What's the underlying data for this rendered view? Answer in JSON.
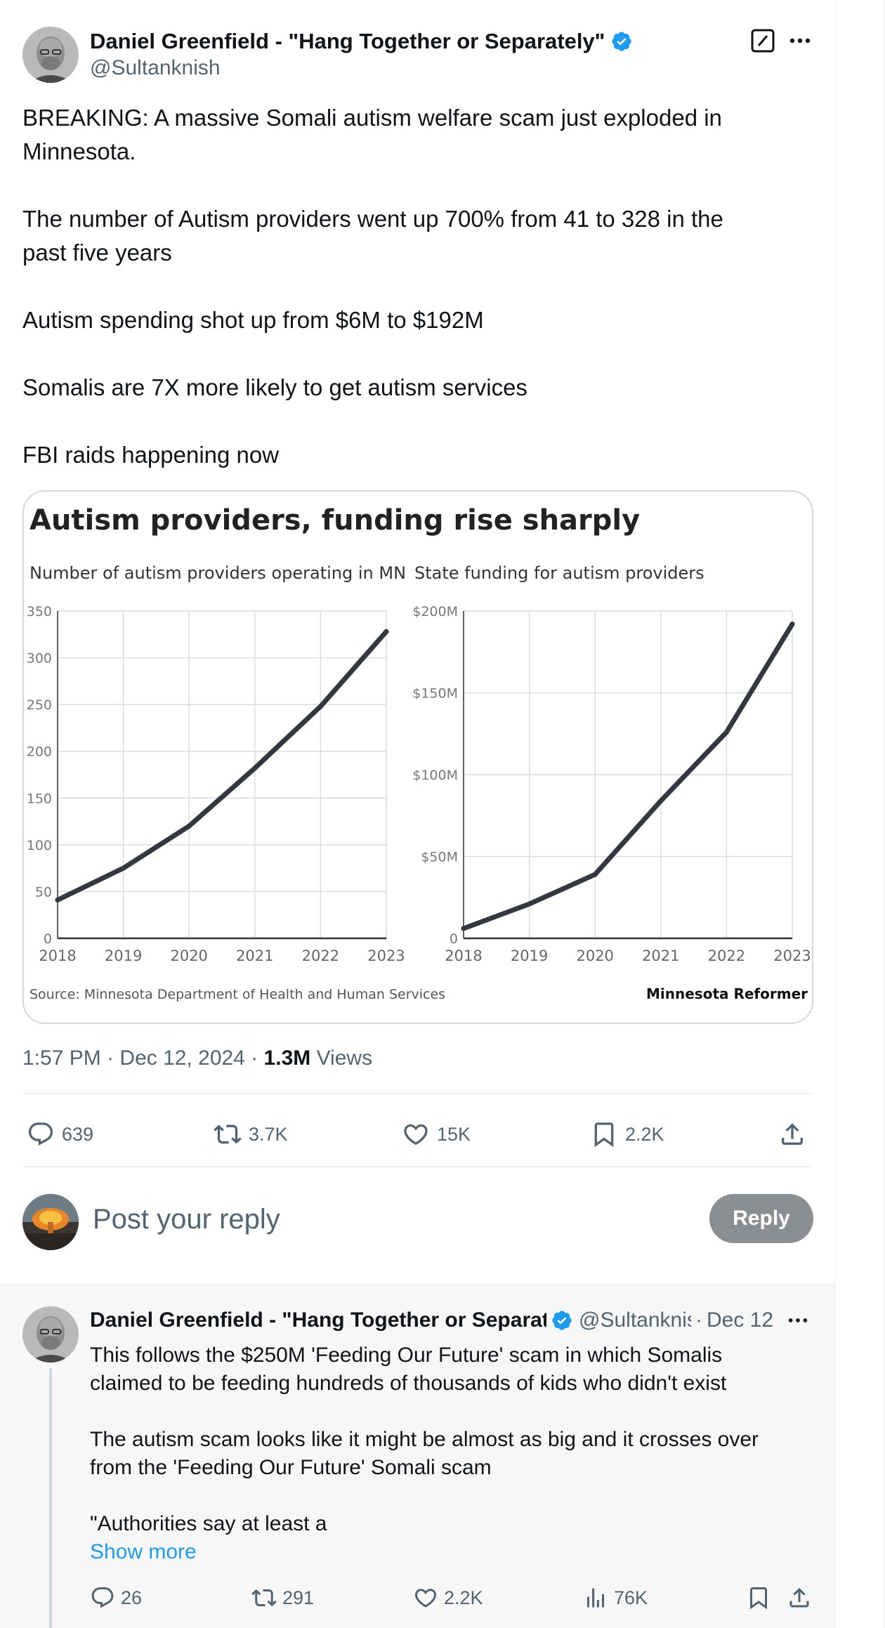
{
  "tweet": {
    "author_name": "Daniel Greenfield - \"Hang Together or Separately\"",
    "author_handle": "@Sultanknish",
    "text_lines": [
      "BREAKING: A massive Somali autism welfare scam just exploded in",
      "Minnesota.",
      "",
      "The number of Autism providers went up 700% from 41 to 328 in the",
      "past five years",
      "",
      "Autism spending shot up from $6M to $192M",
      "",
      "Somalis are 7X more likely to get autism services",
      "",
      "FBI raids happening now"
    ],
    "time": "1:57 PM",
    "date": "Dec 12, 2024",
    "views_count": "1.3M",
    "views_label": "Views",
    "replies": "639",
    "reposts": "3.7K",
    "likes": "15K",
    "bookmarks": "2.2K"
  },
  "compose": {
    "placeholder": "Post your reply",
    "button_label": "Reply"
  },
  "reply": {
    "author_name": "Daniel Greenfield - \"Hang Together or Separately\"",
    "author_handle": "@Sultanknish",
    "dot": "·",
    "date": "Dec 12",
    "text_lines": [
      "This follows the $250M 'Feeding Our Future' scam in which Somalis",
      "claimed to be feeding hundreds of thousands of kids who didn't exist",
      "",
      "The autism scam looks like it might be almost as big and it crosses over",
      "from the 'Feeding Our Future' Somali scam",
      "",
      "\"Authorities say at least a"
    ],
    "show_more": "Show more",
    "replies": "26",
    "reposts": "291",
    "likes": "2.2K",
    "views": "76K"
  },
  "colors": {
    "accent": "#1d9bf0",
    "muted": "#536471",
    "line": "#333740"
  },
  "chart_data": [
    {
      "type": "line",
      "title": "Autism providers, funding rise sharply",
      "subtitle": "Number of autism providers operating in MN",
      "x": [
        "2018",
        "2019",
        "2020",
        "2021",
        "2022",
        "2023"
      ],
      "values": [
        41,
        75,
        120,
        182,
        248,
        328
      ],
      "ylim": [
        0,
        350
      ],
      "yticks": [
        "0",
        "50",
        "100",
        "150",
        "200",
        "250",
        "300",
        "350"
      ],
      "grid": true
    },
    {
      "type": "line",
      "subtitle": "State funding for autism providers",
      "x": [
        "2018",
        "2019",
        "2020",
        "2021",
        "2022",
        "2023"
      ],
      "values": [
        6,
        21,
        39,
        84,
        126,
        192
      ],
      "ylim": [
        0,
        200
      ],
      "yticks": [
        "0",
        "$50M",
        "$100M",
        "$150M",
        "$200M"
      ],
      "grid": true
    }
  ],
  "chart_footer": {
    "source": "Source: Minnesota Department of Health and Human Services",
    "publisher": "Minnesota Reformer"
  }
}
